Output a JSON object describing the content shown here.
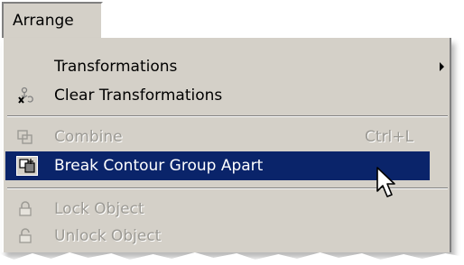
{
  "menubar": {
    "label": "Arrange"
  },
  "menu": {
    "items": [
      {
        "label": "Transformations",
        "shortcut": "",
        "icon": "none",
        "enabled": true,
        "has_submenu": true
      },
      {
        "label": "Clear Transformations",
        "shortcut": "",
        "icon": "clear-transformations-icon",
        "enabled": true,
        "has_submenu": false
      },
      {
        "label": "Combine",
        "shortcut": "Ctrl+L",
        "icon": "combine-icon",
        "enabled": false,
        "has_submenu": false
      },
      {
        "label": "Break Contour Group Apart",
        "shortcut": "",
        "icon": "break-apart-icon",
        "enabled": true,
        "highlighted": true
      },
      {
        "label": "Lock Object",
        "shortcut": "",
        "icon": "lock-icon",
        "enabled": false
      },
      {
        "label": "Unlock Object",
        "shortcut": "",
        "icon": "unlock-icon",
        "enabled": false
      }
    ]
  },
  "colors": {
    "menu_bg": "#d4d0c8",
    "highlight_bg": "#0a246a",
    "disabled_text": "#9c9a94"
  }
}
